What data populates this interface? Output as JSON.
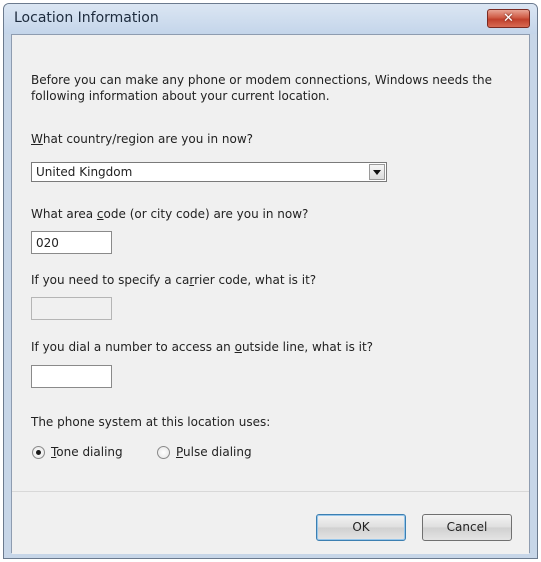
{
  "window": {
    "title": "Location Information",
    "close_icon": "close-icon"
  },
  "intro_text": "Before you can make any phone or modem connections, Windows needs the following information about your current location.",
  "country": {
    "label_accel": "W",
    "label_rest": "hat country/region are you in now?",
    "value": "United Kingdom",
    "dropdown_icon": "chevron-down-icon"
  },
  "area_code": {
    "label_pre": "What area ",
    "label_accel": "c",
    "label_post": "ode (or city code) are you in now?",
    "value": "020"
  },
  "carrier_code": {
    "label_pre": "If you need to specify a ca",
    "label_accel": "r",
    "label_post": "rier code, what is it?",
    "value": ""
  },
  "outside_line": {
    "label_pre": "If you dial a number to access an ",
    "label_accel": "o",
    "label_post": "utside line, what is it?",
    "value": ""
  },
  "phone_system": {
    "label": "The phone system at this location uses:",
    "tone": {
      "accel": "T",
      "rest": "one dialing",
      "checked": true
    },
    "pulse": {
      "accel": "P",
      "rest": "ulse dialing",
      "checked": false
    }
  },
  "buttons": {
    "ok": "OK",
    "cancel": "Cancel"
  }
}
